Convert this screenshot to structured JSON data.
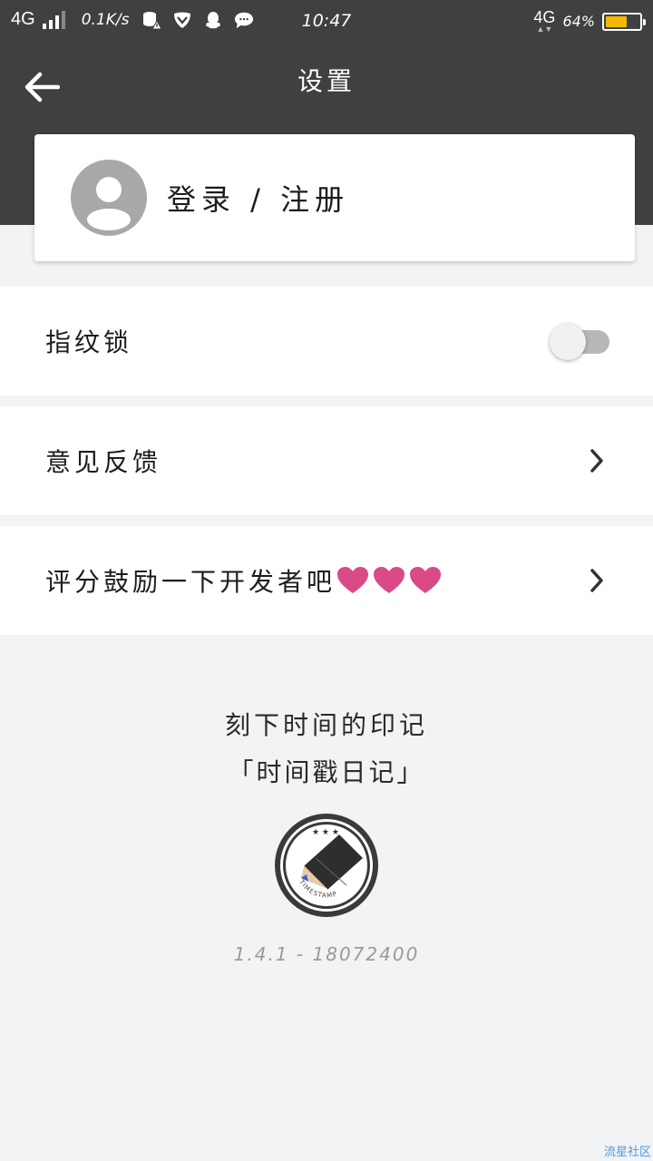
{
  "status_bar": {
    "network": "4G",
    "speed": "0.1K/s",
    "time": "10:47",
    "right_network": "4G",
    "battery_percent": "64%",
    "battery_level": 0.64,
    "battery_color": "#f5b800",
    "icons": [
      "data-warning-icon",
      "vpn-shield-icon",
      "qq-icon",
      "chat-bubble-icon"
    ]
  },
  "header": {
    "title": "设置",
    "background": "#3f4041",
    "back_icon": "arrow-left-icon"
  },
  "login": {
    "label": "登录 / 注册",
    "avatar_icon": "user-avatar-icon"
  },
  "settings": {
    "fingerprint": {
      "label": "指纹锁",
      "enabled": false
    },
    "feedback": {
      "label": "意见反馈"
    },
    "rate": {
      "label": "评分鼓励一下开发者吧",
      "hearts": 3,
      "heart_color": "#d94a86"
    }
  },
  "footer": {
    "slogan": "刻下时间的印记",
    "app_name": "「时间戳日记」",
    "logo_text": "TIMESTAMP",
    "version": "1.4.1 - 18072400"
  },
  "watermark": "流星社区"
}
